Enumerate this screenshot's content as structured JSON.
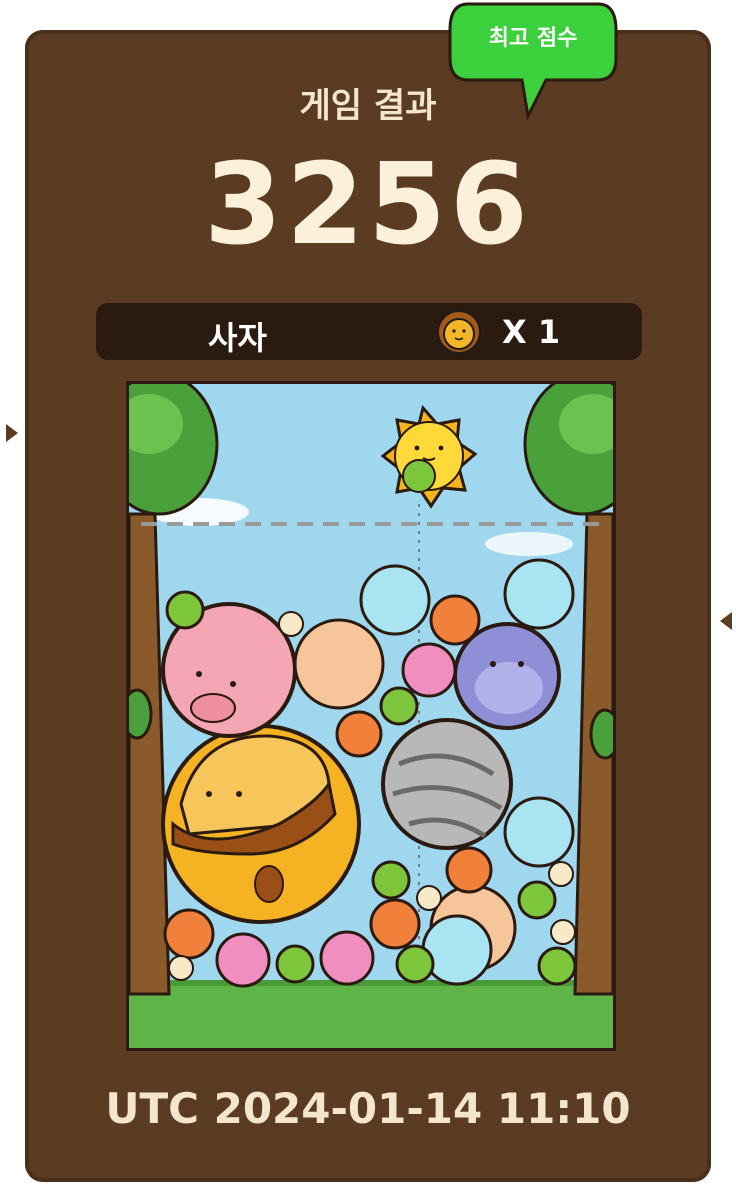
{
  "badge": {
    "label": "최고 점수",
    "color": "#3cd03c"
  },
  "header": {
    "title": "게임 결과"
  },
  "score": "3256",
  "result": {
    "animal": "사자",
    "icon": "lion-icon",
    "count": "X 1"
  },
  "board": {
    "sky_color": "#9fd8ee",
    "grass_color": "#5fb548",
    "pieces": [
      "sun",
      "lion",
      "pig",
      "zebra",
      "penguin",
      "hamster",
      "cat",
      "elephant",
      "squirrel",
      "turtle",
      "egg"
    ]
  },
  "timestamp": "UTC 2024-01-14 11:10",
  "colors": {
    "card": "#5b3b22",
    "bar": "#2a1a10",
    "text": "#fbf1da"
  }
}
